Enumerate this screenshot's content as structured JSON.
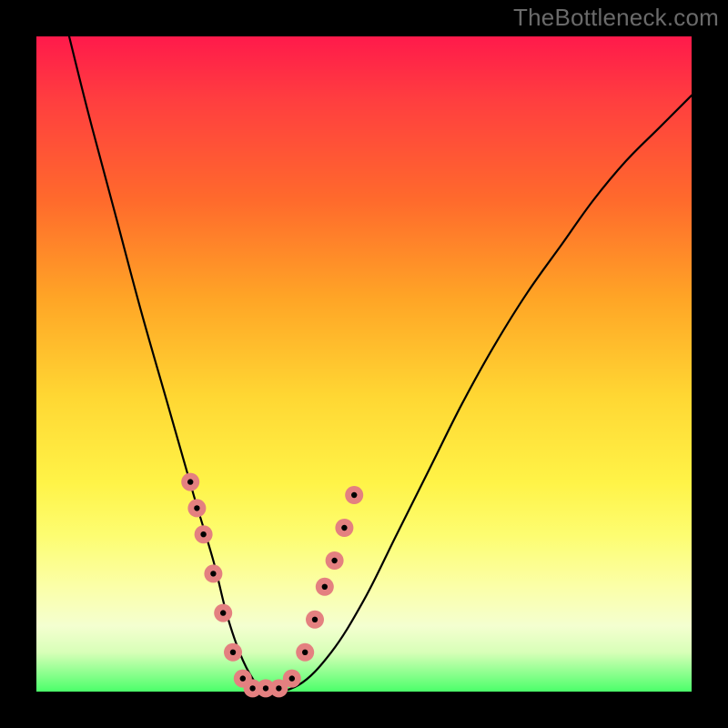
{
  "watermark": "TheBottleneck.com",
  "chart_data": {
    "type": "line",
    "title": "",
    "xlabel": "",
    "ylabel": "",
    "xlim": [
      0,
      100
    ],
    "ylim": [
      0,
      100
    ],
    "gradient_stops": [
      {
        "pct": 0,
        "color": "#ff1a4b"
      },
      {
        "pct": 10,
        "color": "#ff3f3f"
      },
      {
        "pct": 25,
        "color": "#ff6a2c"
      },
      {
        "pct": 40,
        "color": "#ffa526"
      },
      {
        "pct": 55,
        "color": "#ffd733"
      },
      {
        "pct": 68,
        "color": "#fff347"
      },
      {
        "pct": 76,
        "color": "#fdfd70"
      },
      {
        "pct": 84,
        "color": "#fbffa8"
      },
      {
        "pct": 90,
        "color": "#f4ffd0"
      },
      {
        "pct": 94,
        "color": "#d8ffb8"
      },
      {
        "pct": 100,
        "color": "#4bff6a"
      }
    ],
    "series": [
      {
        "name": "bottleneck-curve",
        "x": [
          5,
          8,
          12,
          16,
          20,
          24,
          27,
          29,
          31,
          33,
          35,
          40,
          45,
          50,
          55,
          60,
          65,
          70,
          75,
          80,
          85,
          90,
          95,
          100
        ],
        "y": [
          100,
          88,
          73,
          58,
          44,
          30,
          20,
          12,
          6,
          2,
          0,
          1,
          6,
          14,
          24,
          34,
          44,
          53,
          61,
          68,
          75,
          81,
          86,
          91
        ]
      }
    ],
    "markers": {
      "color": "#e48080",
      "points": [
        {
          "x": 23.5,
          "y": 32
        },
        {
          "x": 24.5,
          "y": 28
        },
        {
          "x": 25.5,
          "y": 24
        },
        {
          "x": 27,
          "y": 18
        },
        {
          "x": 28.5,
          "y": 12
        },
        {
          "x": 30,
          "y": 6
        },
        {
          "x": 31.5,
          "y": 2
        },
        {
          "x": 33,
          "y": 0.5
        },
        {
          "x": 35,
          "y": 0.5
        },
        {
          "x": 37,
          "y": 0.5
        },
        {
          "x": 39,
          "y": 2
        },
        {
          "x": 41,
          "y": 6
        },
        {
          "x": 42.5,
          "y": 11
        },
        {
          "x": 44,
          "y": 16
        },
        {
          "x": 45.5,
          "y": 20
        },
        {
          "x": 47,
          "y": 25
        },
        {
          "x": 48.5,
          "y": 30
        }
      ]
    }
  }
}
